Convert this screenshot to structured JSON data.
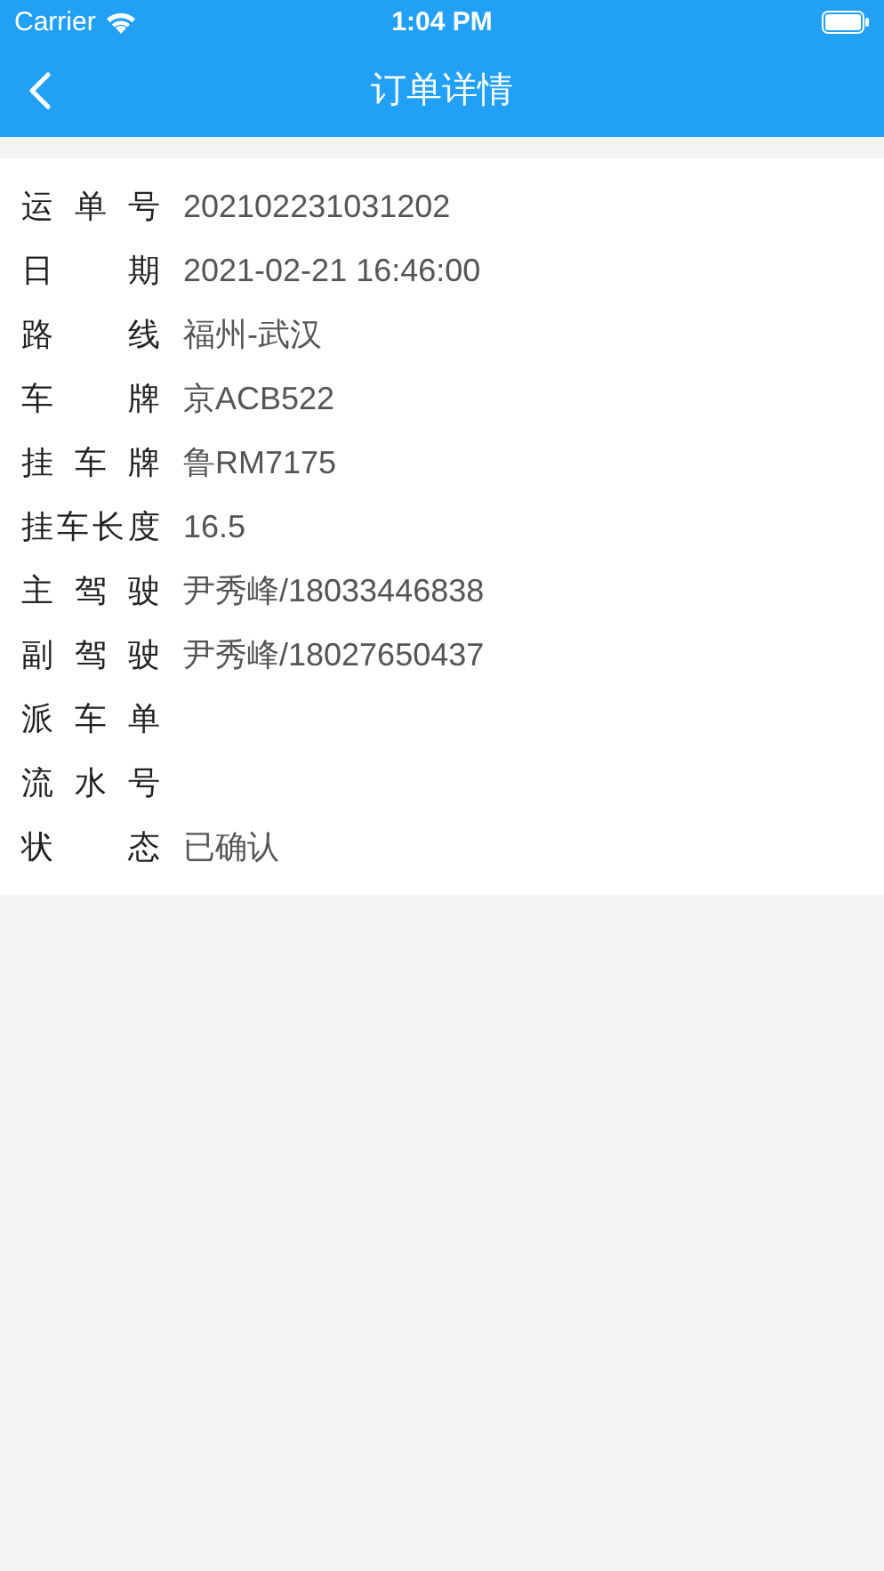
{
  "status_bar": {
    "carrier": "Carrier",
    "time": "1:04 PM"
  },
  "nav_bar": {
    "title": "订单详情"
  },
  "details": [
    {
      "label": "运单号",
      "value": "202102231031202"
    },
    {
      "label": "日期",
      "value": "2021-02-21 16:46:00"
    },
    {
      "label": "路线",
      "value": "福州-武汉"
    },
    {
      "label": "车牌",
      "value": "京ACB522"
    },
    {
      "label": "挂车牌",
      "value": "鲁RM7175"
    },
    {
      "label": "挂车长度",
      "value": "16.5"
    },
    {
      "label": "主驾驶",
      "value": "尹秀峰/18033446838"
    },
    {
      "label": "副驾驶",
      "value": "尹秀峰/18027650437"
    },
    {
      "label": "派车单"
    },
    {
      "label": "流水号"
    },
    {
      "label": "状态",
      "value": "已确认"
    }
  ]
}
